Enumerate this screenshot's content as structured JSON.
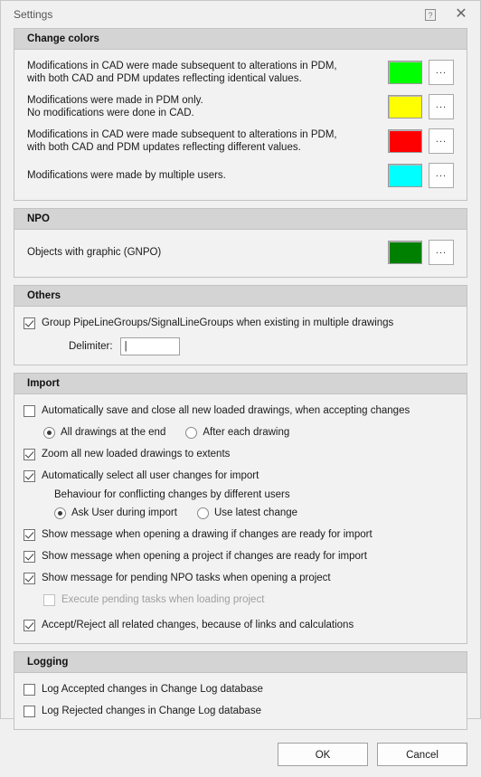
{
  "window": {
    "title": "Settings",
    "help_icon": "help-question-icon",
    "close_icon": "close-icon"
  },
  "sections": {
    "change_colors": {
      "title": "Change colors",
      "rows": [
        {
          "line1": "Modifications in CAD were made subsequent to alterations in PDM,",
          "line2": "with both CAD and PDM updates reflecting identical values.",
          "color": "#00ff00",
          "button": "..."
        },
        {
          "line1": "Modifications were made in PDM only.",
          "line2": "No modifications were done in CAD.",
          "color": "#ffff00",
          "button": "..."
        },
        {
          "line1": "Modifications in CAD were made subsequent to alterations in PDM,",
          "line2": "with both CAD and PDM updates reflecting different values.",
          "color": "#ff0000",
          "button": "..."
        },
        {
          "line1": "Modifications were made by multiple users.",
          "line2": "",
          "color": "#00ffff",
          "button": "..."
        }
      ]
    },
    "npo": {
      "title": "NPO",
      "row": {
        "label": "Objects with graphic (GNPO)",
        "color": "#008000",
        "button": "..."
      }
    },
    "others": {
      "title": "Others",
      "group_checkbox": {
        "label": "Group PipeLineGroups/SignalLineGroups when existing in multiple drawings",
        "checked": true
      },
      "delimiter": {
        "label": "Delimiter:",
        "value": "|",
        "placeholder": ""
      }
    },
    "import": {
      "title": "Import",
      "auto_save_close": {
        "label": "Automatically save and close all new loaded drawings, when accepting changes",
        "checked": false
      },
      "save_mode_options": [
        {
          "label": "All drawings at the end",
          "selected": true
        },
        {
          "label": "After each drawing",
          "selected": false
        }
      ],
      "zoom_extents": {
        "label": "Zoom all new loaded drawings to extents",
        "checked": true
      },
      "auto_select_changes": {
        "label": "Automatically select all user changes for import",
        "checked": true
      },
      "conflict_heading": "Behaviour for conflicting changes by different users",
      "conflict_options": [
        {
          "label": "Ask User during import",
          "selected": true
        },
        {
          "label": "Use latest change",
          "selected": false
        }
      ],
      "show_drawing_msg": {
        "label": "Show message when opening a drawing if changes are ready for import",
        "checked": true
      },
      "show_project_msg": {
        "label": "Show message when opening a project if changes are ready for import",
        "checked": true
      },
      "show_npo_msg": {
        "label": "Show message for pending NPO tasks when opening a project",
        "checked": true
      },
      "execute_pending": {
        "label": "Execute pending tasks when loading project",
        "checked": false,
        "disabled": true
      },
      "accept_reject_related": {
        "label": "Accept/Reject all related changes, because of links and calculations",
        "checked": true
      }
    },
    "logging": {
      "title": "Logging",
      "log_accepted": {
        "label": "Log Accepted changes in Change Log database",
        "checked": false
      },
      "log_rejected": {
        "label": "Log Rejected changes in Change Log database",
        "checked": false
      }
    }
  },
  "footer": {
    "ok": "OK",
    "cancel": "Cancel"
  }
}
